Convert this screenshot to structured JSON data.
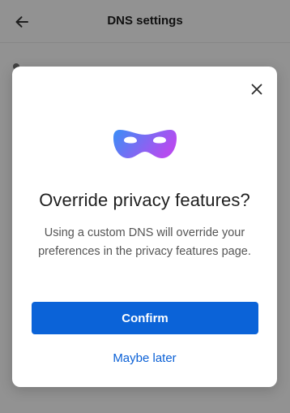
{
  "header": {
    "title": "DNS settings",
    "back_icon": "arrow-left-icon"
  },
  "dialog": {
    "close_icon": "close-icon",
    "illustration_icon": "mask-icon",
    "title": "Override privacy features?",
    "body": "Using a custom DNS will override your preferences in the privacy features page.",
    "confirm_label": "Confirm",
    "later_label": "Maybe later"
  },
  "colors": {
    "primary": "#0b63d8",
    "link": "#0a60d6",
    "mask_gradient_start": "#3a8ef6",
    "mask_gradient_end": "#b54cf0"
  }
}
